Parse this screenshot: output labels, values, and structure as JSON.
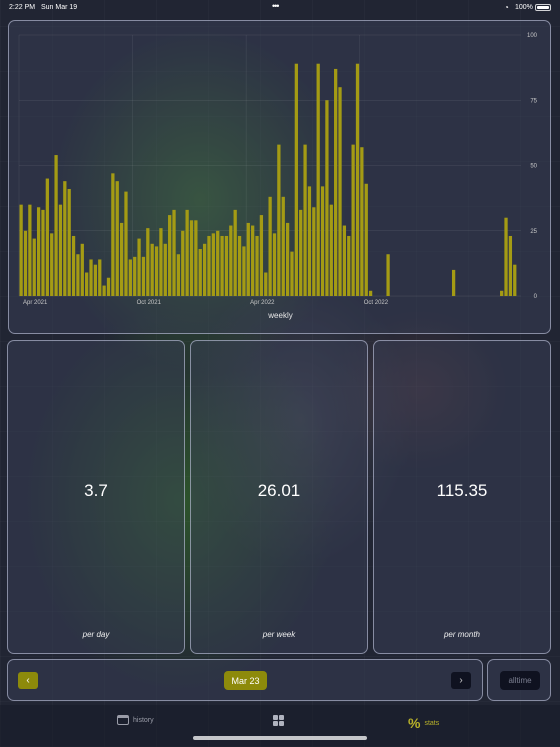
{
  "status": {
    "time": "2:22 PM",
    "date": "Sun Mar 19",
    "more": "•••",
    "battery": "100%"
  },
  "chart_data": {
    "type": "bar",
    "xlabel": "weekly",
    "ylim": [
      0,
      100
    ],
    "y_ticks": [
      "0",
      "25",
      "50",
      "75",
      "100"
    ],
    "x_tick_labels": [
      "Apr 2021",
      "Oct 2021",
      "Apr 2022",
      "Oct 2022"
    ],
    "x_tick_positions": [
      0,
      26,
      52,
      78
    ],
    "bar_color": "#a49b14",
    "values": [
      35,
      25,
      35,
      22,
      34,
      33,
      45,
      24,
      54,
      35,
      44,
      41,
      23,
      16,
      20,
      9,
      14,
      12,
      14,
      4,
      7,
      47,
      44,
      28,
      40,
      14,
      15,
      22,
      15,
      26,
      20,
      19,
      26,
      20,
      31,
      33,
      16,
      25,
      33,
      29,
      29,
      18,
      20,
      23,
      24,
      25,
      23,
      23,
      27,
      33,
      23,
      19,
      28,
      27,
      23,
      31,
      9,
      38,
      24,
      58,
      38,
      28,
      17,
      89,
      33,
      58,
      42,
      34,
      89,
      42,
      75,
      35,
      87,
      80,
      27,
      23,
      58,
      89,
      57,
      43,
      2,
      0,
      0,
      0,
      16,
      0,
      0,
      0,
      0,
      0,
      0,
      0,
      0,
      0,
      0,
      0,
      0,
      0,
      0,
      10,
      0,
      0,
      0,
      0,
      0,
      0,
      0,
      0,
      0,
      0,
      2,
      30,
      23,
      12
    ]
  },
  "stats": {
    "per_day": {
      "value": "3.7",
      "label": "per day"
    },
    "per_week": {
      "value": "26.01",
      "label": "per week"
    },
    "per_month": {
      "value": "115.35",
      "label": "per month"
    }
  },
  "navigator": {
    "prev_icon": "chevron-left-icon",
    "prev_glyph": "‹",
    "current": "Mar 23",
    "next_icon": "chevron-right-icon",
    "next_glyph": "›",
    "alltime": "alltime"
  },
  "tabbar": {
    "history": "history",
    "stats": "stats",
    "stats_glyph": "%",
    "active": "stats",
    "accent": "#b8b12a"
  }
}
